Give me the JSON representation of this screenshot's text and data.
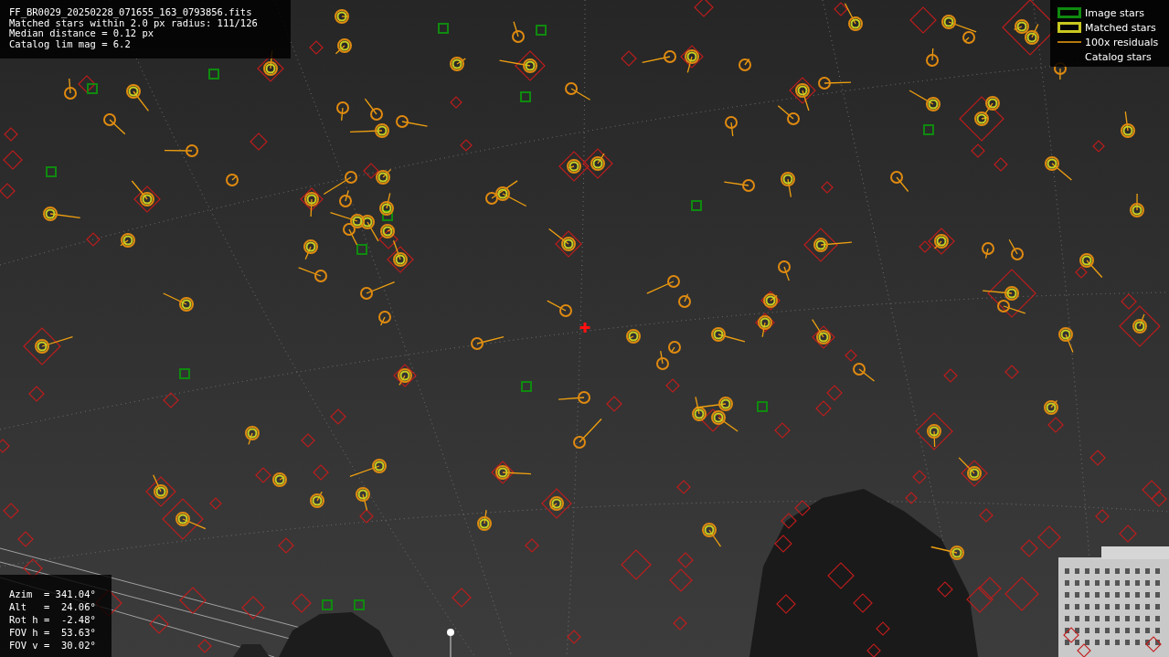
{
  "info": {
    "lines": [
      "FF_BR0029_20250228_071655_163_0793856.fits",
      "Matched stars within 2.0 px radius: 111/126",
      "Median distance = 0.12 px",
      "Catalog lim mag = 6.2"
    ]
  },
  "legend": [
    {
      "kind": "image",
      "label": "Image stars"
    },
    {
      "kind": "matched",
      "label": "Matched stars"
    },
    {
      "kind": "residual",
      "label": "100x residuals"
    },
    {
      "kind": "catalog",
      "label": "Catalog stars"
    }
  ],
  "pointing": {
    "lines": [
      "Azim  = 341.04°",
      "Alt   =  24.06°",
      "Rot h =  -2.48°",
      "FOV h =  53.63°",
      "FOV v =  30.02°"
    ]
  }
}
